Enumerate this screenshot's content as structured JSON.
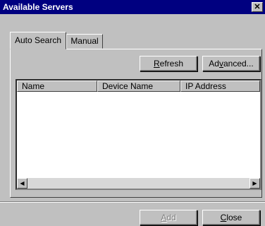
{
  "window": {
    "title": "Available Servers",
    "close_glyph": "✕"
  },
  "tabs": [
    {
      "label": "Auto Search",
      "active": true
    },
    {
      "label": "Manual",
      "active": false
    }
  ],
  "toolbar": {
    "refresh": {
      "mnemonic": "R",
      "rest": "efresh"
    },
    "advanced": {
      "pre": "Ad",
      "mnemonic": "v",
      "post": "anced..."
    }
  },
  "list": {
    "columns": [
      "Name",
      "Device Name",
      "IP Address"
    ],
    "rows": []
  },
  "scrollbar": {
    "left_arrow": "◀",
    "right_arrow": "▶"
  },
  "footer": {
    "add": {
      "mnemonic": "A",
      "rest": "dd",
      "disabled": true
    },
    "close": {
      "mnemonic": "C",
      "rest": "lose"
    }
  }
}
